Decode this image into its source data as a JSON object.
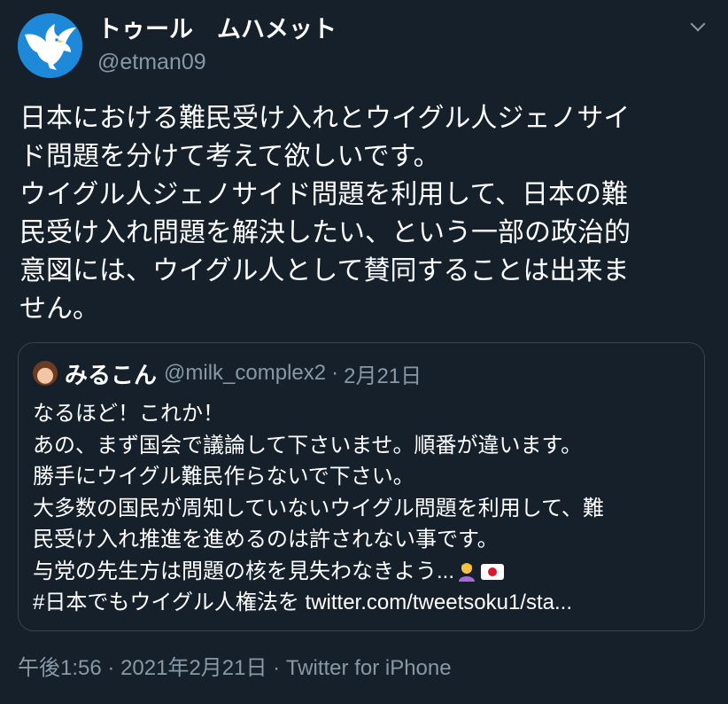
{
  "author": {
    "display_name": "トゥール　ムハメット",
    "handle": "@etman09",
    "avatar_icon": "eagle-icon"
  },
  "more_icon": "chevron-down-icon",
  "tweet": {
    "lines": [
      "日本における難民受け入れとウイグル人ジェノサイ",
      "ド問題を分けて考えて欲しいです。",
      "ウイグル人ジェノサイド問題を利用して、日本の難",
      "民受け入れ問題を解決したい、という一部の政治的",
      "意図には、ウイグル人として賛同することは出来ま",
      "せん。"
    ]
  },
  "quoted_tweet": {
    "display_name": "みるこん",
    "handle": "@milk_complex2",
    "separator": "·",
    "date": "2月21日",
    "lines": [
      "なるほど！これか！",
      "あの、まず国会で議論して下さいませ。順番が違います。",
      "勝手にウイグル難民作らないで下さい。",
      "大多数の国民が周知していないウイグル問題を利用して、難",
      "民受け入れ推進を進めるのは許されない事です。",
      "与党の先生方は問題の核を見失わなきよう..."
    ],
    "last_line": "#日本でもウイグル人権法を twitter.com/tweetsoku1/sta...",
    "emoji": [
      "person-bowing-icon",
      "japan-flag-icon"
    ]
  },
  "timestamp": {
    "time": "午後1:56",
    "date": "2021年2月21日",
    "source": "Twitter for iPhone",
    "separator": "·"
  },
  "colors": {
    "background": "#15202b",
    "secondary_text": "#8899a6",
    "border": "#38444d",
    "avatar_blue": "#1e88d9"
  }
}
